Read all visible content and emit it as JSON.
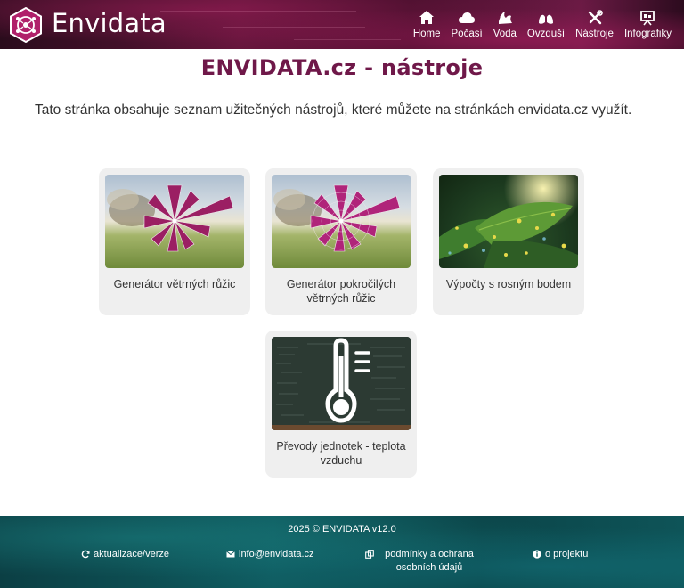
{
  "header": {
    "brand": "Envidata",
    "nav": [
      {
        "label": "Home",
        "icon": "home-icon"
      },
      {
        "label": "Počasí",
        "icon": "cloud-icon"
      },
      {
        "label": "Voda",
        "icon": "water-icon"
      },
      {
        "label": "Ovzduší",
        "icon": "lungs-icon"
      },
      {
        "label": "Nástroje",
        "icon": "tools-icon"
      },
      {
        "label": "Infografiky",
        "icon": "presentation-icon"
      }
    ]
  },
  "main": {
    "title": "ENVIDATA.cz - nástroje",
    "intro": "Tato stránka obsahuje seznam užitečných nástrojů, které můžete na stránkách envidata.cz využít.",
    "cards": [
      {
        "caption": "Generátor větrných růžic",
        "image": "wind-rose-meadow"
      },
      {
        "caption": "Generátor pokročilých větrných růžic",
        "image": "wind-rose-meadow"
      },
      {
        "caption": "Výpočty s rosným bodem",
        "image": "dew-leaves"
      },
      {
        "caption": "Převody jednotek - teplota vzduchu",
        "image": "thermometer-chalkboard"
      }
    ]
  },
  "footer": {
    "copyright": "2025 © ENVIDATA v12.0",
    "links": [
      {
        "label": "aktualizace/verze",
        "icon": "refresh-icon"
      },
      {
        "label": "info@envidata.cz",
        "icon": "envelope-icon"
      },
      {
        "label": "podmínky a ochrana osobních údajů",
        "icon": "copy-icon"
      },
      {
        "label": "o projektu",
        "icon": "info-icon"
      }
    ]
  },
  "colors": {
    "accent": "#6f1849",
    "header_bg": "#5a1436",
    "footer_bg": "#0f5a5e",
    "card_bg": "#efefef"
  }
}
